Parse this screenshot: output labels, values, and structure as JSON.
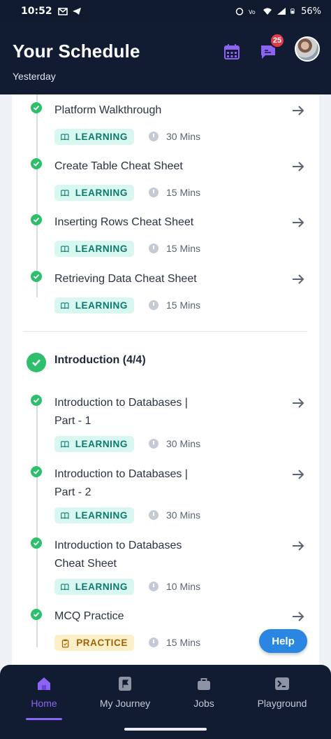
{
  "status_bar": {
    "time": "10:52",
    "battery": "56%"
  },
  "header": {
    "title": "Your Schedule",
    "subtitle": "Yesterday",
    "chat_badge": "25"
  },
  "items_top": [
    {
      "title": "Platform Walkthrough",
      "tag": "LEARNING",
      "duration": "30 Mins"
    },
    {
      "title": "Create Table Cheat Sheet",
      "tag": "LEARNING",
      "duration": "15 Mins"
    },
    {
      "title": "Inserting Rows Cheat Sheet",
      "tag": "LEARNING",
      "duration": "15 Mins"
    },
    {
      "title": "Retrieving Data Cheat Sheet",
      "tag": "LEARNING",
      "duration": "15 Mins"
    }
  ],
  "section": {
    "title": "Introduction (4/4)"
  },
  "items_section": [
    {
      "title": "Introduction to Databases | Part - 1",
      "tag": "LEARNING",
      "duration": "30 Mins"
    },
    {
      "title": "Introduction to Databases | Part - 2",
      "tag": "LEARNING",
      "duration": "30 Mins"
    },
    {
      "title": "Introduction to Databases Cheat Sheet",
      "tag": "LEARNING",
      "duration": "10 Mins"
    },
    {
      "title": "MCQ Practice",
      "tag": "PRACTICE",
      "duration": "15 Mins"
    }
  ],
  "help_label": "Help",
  "nav": [
    {
      "label": "Home",
      "active": true
    },
    {
      "label": "My Journey",
      "active": false
    },
    {
      "label": "Jobs",
      "active": false
    },
    {
      "label": "Playground",
      "active": false
    }
  ],
  "colors": {
    "accent": "#8b63f5",
    "header_bg": "#111c33",
    "check": "#2dbf6c",
    "learning": "#0b7a6c",
    "practice": "#a06208",
    "help": "#2a86e0"
  },
  "icons": {
    "calendar": "calendar-icon",
    "chat": "chat-icon",
    "arrow": "arrow-right-icon",
    "book": "book-icon",
    "clipboard": "clipboard-icon",
    "clock": "clock-icon"
  }
}
